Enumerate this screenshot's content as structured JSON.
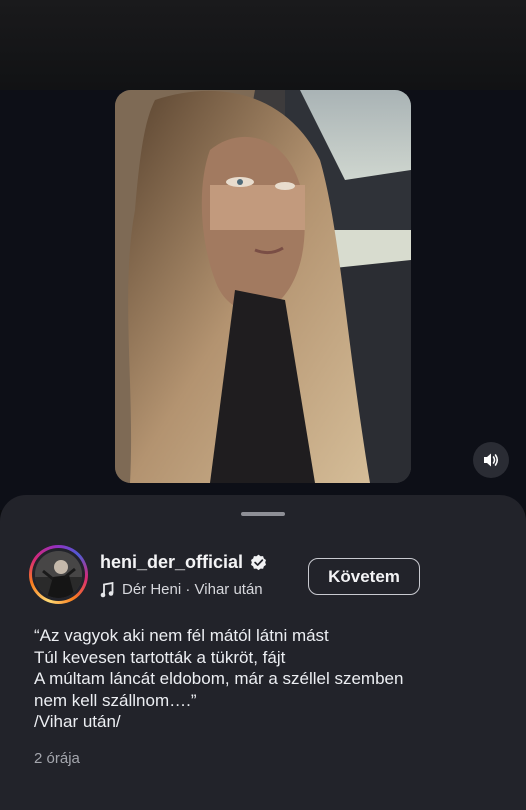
{
  "post": {
    "username": "heni_der_official",
    "verified_icon": "verified-badge-icon",
    "follow_label": "Követem",
    "music": {
      "icon": "music-note-icon",
      "artist": "Dér Heni",
      "separator": "·",
      "song": "Vihar után"
    },
    "caption_lines": [
      "“Az vagyok aki nem fél mától látni mást",
      "Túl kevesen tartották a tükröt, fájt",
      "A múltam láncát eldobom, már a széllel szemben",
      "nem kell szállnom….”",
      "/Vihar után/"
    ],
    "timestamp": "2 órája"
  },
  "video": {
    "sound_icon": "speaker-icon"
  }
}
